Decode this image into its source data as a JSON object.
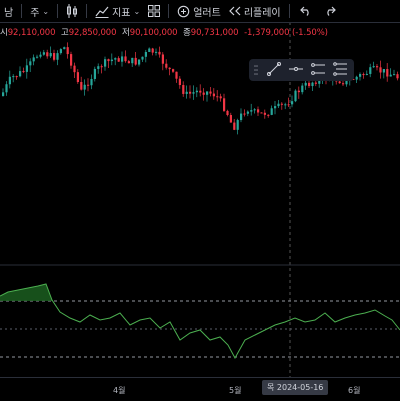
{
  "toolbar": {
    "interval_partial": "남",
    "week": "주",
    "indicators_label": "지표",
    "alerts_label": "얼러트",
    "replay_label": "리플레이"
  },
  "ohlc": {
    "open_key": "시",
    "open": "92,110,000",
    "high_key": "고",
    "high": "92,850,000",
    "low_key": "저",
    "low": "90,100,000",
    "close_key": "종",
    "close": "90,731,000",
    "change": "-1,379,000 (-1.50%)"
  },
  "colors": {
    "up": "#26a69a",
    "down": "#f23645",
    "indicator": "#4caf50",
    "background": "#000000"
  },
  "drawing_tools": [
    "trend-line-tool",
    "horizontal-line-tool",
    "parallel-channel-tool",
    "fib-retracement-tool"
  ],
  "xaxis": {
    "labels": [
      "4월",
      "5월",
      "6월"
    ],
    "crosshair_date": "목 2024-05-16"
  }
}
